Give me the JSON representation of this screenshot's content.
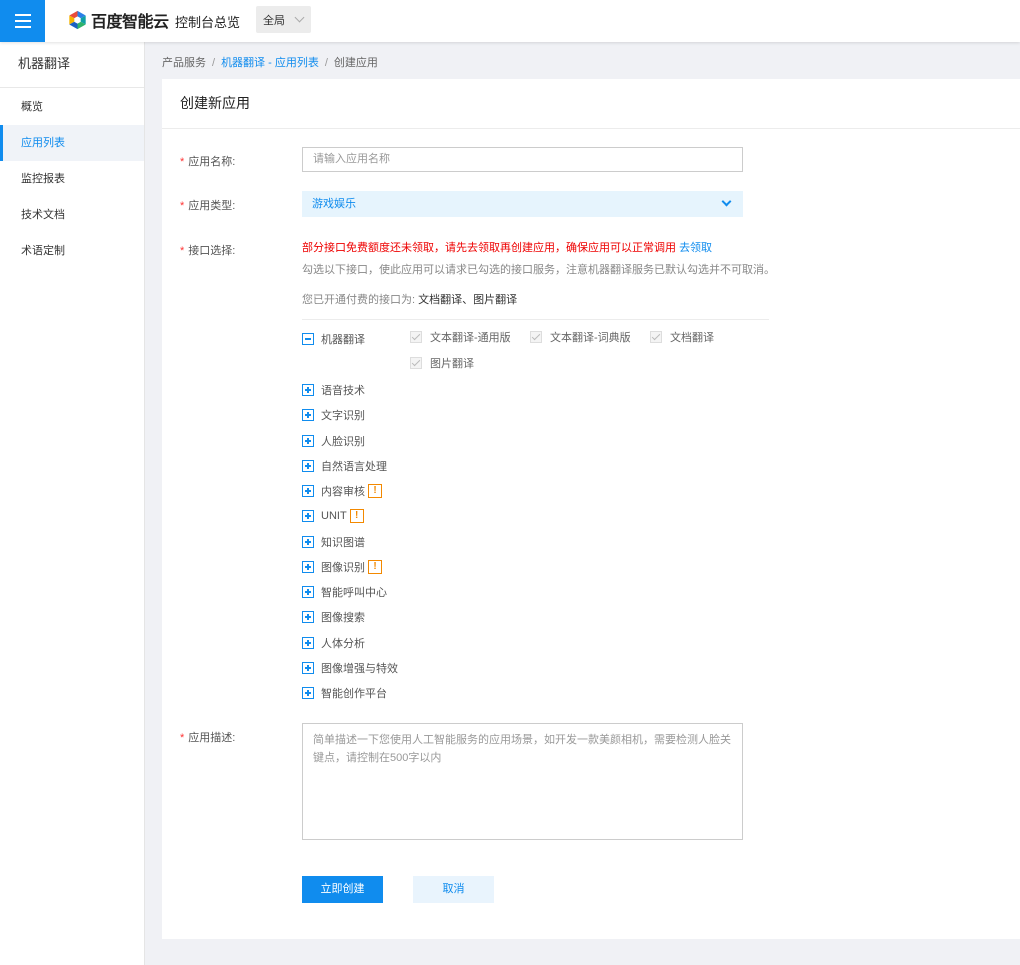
{
  "header": {
    "logo_text": "百度智能云",
    "console_title": "控制台总览",
    "region": "全局"
  },
  "sidebar": {
    "title": "机器翻译",
    "items": [
      {
        "label": "概览"
      },
      {
        "label": "应用列表"
      },
      {
        "label": "监控报表"
      },
      {
        "label": "技术文档"
      },
      {
        "label": "术语定制"
      }
    ]
  },
  "breadcrumb": {
    "root": "产品服务",
    "parent": "机器翻译 - 应用列表",
    "current": "创建应用"
  },
  "form": {
    "title": "创建新应用",
    "name_label": "应用名称:",
    "name_placeholder": "请输入应用名称",
    "type_label": "应用类型:",
    "type_value": "游戏娱乐",
    "api_label": "接口选择:",
    "warning": "部分接口免费额度还未领取，请先去领取再创建应用，确保应用可以正常调用",
    "warning_link": "去领取",
    "hint": "勾选以下接口，使此应用可以请求已勾选的接口服务，注意机器翻译服务已默认勾选并不可取消。",
    "paid_label": "您已开通付费的接口为:",
    "paid_value": "文档翻译、图片翻译",
    "desc_label": "应用描述:",
    "desc_placeholder": "简单描述一下您使用人工智能服务的应用场景，如开发一款美颜相机，需要检测人脸关键点，请控制在500字以内",
    "submit_label": "立即创建",
    "cancel_label": "取消"
  },
  "api_tree": {
    "expanded": {
      "label": "机器翻译",
      "children": [
        "文本翻译-通用版",
        "文本翻译-词典版",
        "文档翻译",
        "图片翻译"
      ]
    },
    "collapsed": [
      {
        "label": "语音技术",
        "warning": false
      },
      {
        "label": "文字识别",
        "warning": false
      },
      {
        "label": "人脸识别",
        "warning": false
      },
      {
        "label": "自然语言处理",
        "warning": false
      },
      {
        "label": "内容审核",
        "warning": true
      },
      {
        "label": "UNIT",
        "warning": true
      },
      {
        "label": "知识图谱",
        "warning": false
      },
      {
        "label": "图像识别",
        "warning": true
      },
      {
        "label": "智能呼叫中心",
        "warning": false
      },
      {
        "label": "图像搜索",
        "warning": false
      },
      {
        "label": "人体分析",
        "warning": false
      },
      {
        "label": "图像增强与特效",
        "warning": false
      },
      {
        "label": "智能创作平台",
        "warning": false
      }
    ],
    "warning_symbol": "!"
  },
  "colors": {
    "accent": "#108cee",
    "required": "#ff3333",
    "warning_text": "#ee0000",
    "badge": "#f38900"
  }
}
